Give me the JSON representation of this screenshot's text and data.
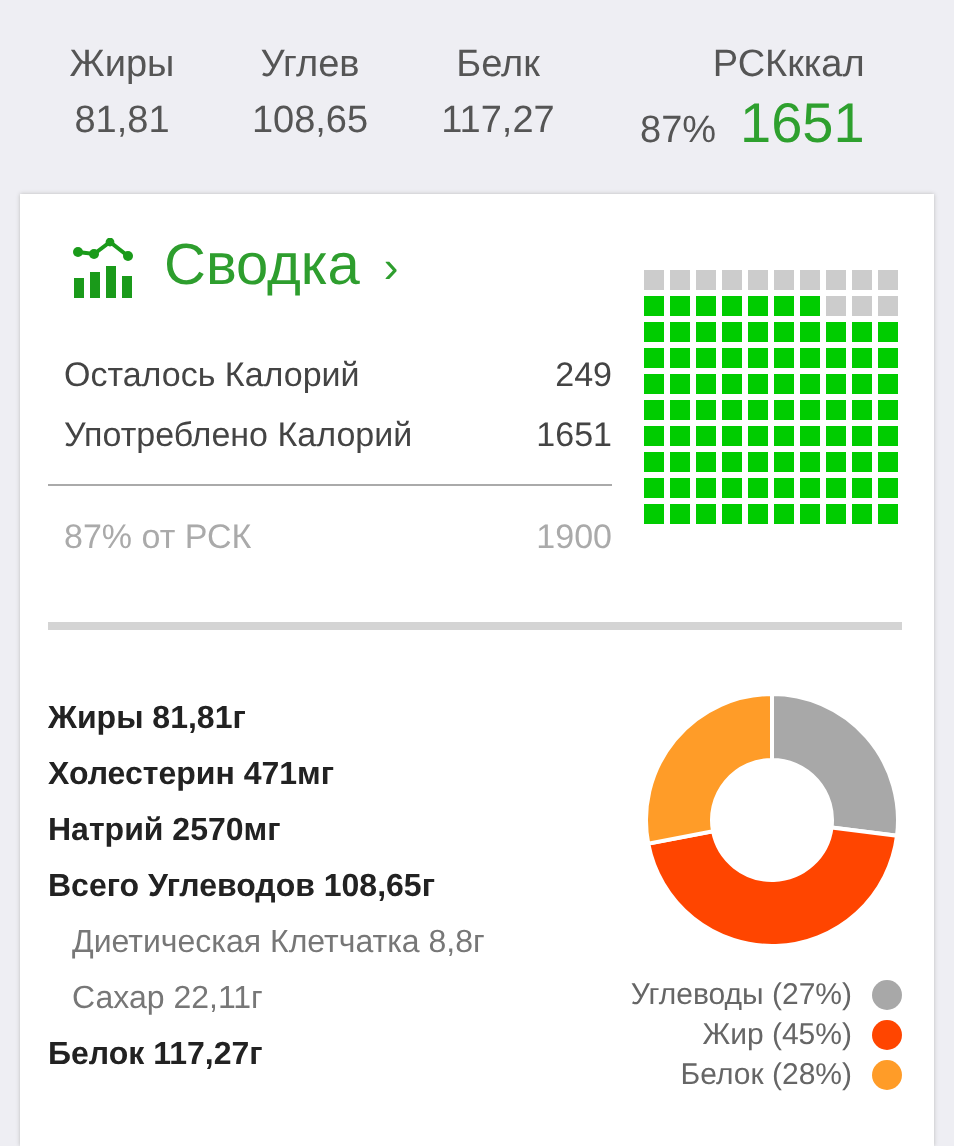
{
  "header": {
    "columns": [
      {
        "label": "Жиры",
        "value": "81,81"
      },
      {
        "label": "Углев",
        "value": "108,65"
      },
      {
        "label": "Белк",
        "value": "117,27"
      }
    ],
    "rsk": {
      "label": "РСКккал",
      "percent": "87%",
      "value": "1651"
    }
  },
  "summary": {
    "title": "Сводка",
    "chevron": "›",
    "rows": [
      {
        "label": "Осталось Калорий",
        "value": "249"
      },
      {
        "label": "Употреблено Калорий",
        "value": "1651"
      }
    ],
    "footer": {
      "label": "87% от РСК",
      "value": "1900"
    },
    "grid": {
      "rows": [
        {
          "cells": [
            {
              "on": false
            },
            {
              "on": false
            },
            {
              "on": false
            },
            {
              "on": false
            },
            {
              "on": false
            },
            {
              "on": false
            },
            {
              "on": false
            },
            {
              "on": false
            },
            {
              "on": false
            },
            {
              "on": false
            }
          ]
        },
        {
          "cells": [
            {
              "on": true
            },
            {
              "on": true
            },
            {
              "on": true
            },
            {
              "on": true
            },
            {
              "on": true
            },
            {
              "on": true
            },
            {
              "on": true
            },
            {
              "on": false
            },
            {
              "on": false
            },
            {
              "on": false
            }
          ]
        },
        {
          "cells": [
            {
              "on": true
            },
            {
              "on": true
            },
            {
              "on": true
            },
            {
              "on": true
            },
            {
              "on": true
            },
            {
              "on": true
            },
            {
              "on": true
            },
            {
              "on": true
            },
            {
              "on": true
            },
            {
              "on": true
            }
          ]
        },
        {
          "cells": [
            {
              "on": true
            },
            {
              "on": true
            },
            {
              "on": true
            },
            {
              "on": true
            },
            {
              "on": true
            },
            {
              "on": true
            },
            {
              "on": true
            },
            {
              "on": true
            },
            {
              "on": true
            },
            {
              "on": true
            }
          ]
        },
        {
          "cells": [
            {
              "on": true
            },
            {
              "on": true
            },
            {
              "on": true
            },
            {
              "on": true
            },
            {
              "on": true
            },
            {
              "on": true
            },
            {
              "on": true
            },
            {
              "on": true
            },
            {
              "on": true
            },
            {
              "on": true
            }
          ]
        },
        {
          "cells": [
            {
              "on": true
            },
            {
              "on": true
            },
            {
              "on": true
            },
            {
              "on": true
            },
            {
              "on": true
            },
            {
              "on": true
            },
            {
              "on": true
            },
            {
              "on": true
            },
            {
              "on": true
            },
            {
              "on": true
            }
          ]
        },
        {
          "cells": [
            {
              "on": true
            },
            {
              "on": true
            },
            {
              "on": true
            },
            {
              "on": true
            },
            {
              "on": true
            },
            {
              "on": true
            },
            {
              "on": true
            },
            {
              "on": true
            },
            {
              "on": true
            },
            {
              "on": true
            }
          ]
        },
        {
          "cells": [
            {
              "on": true
            },
            {
              "on": true
            },
            {
              "on": true
            },
            {
              "on": true
            },
            {
              "on": true
            },
            {
              "on": true
            },
            {
              "on": true
            },
            {
              "on": true
            },
            {
              "on": true
            },
            {
              "on": true
            }
          ]
        },
        {
          "cells": [
            {
              "on": true
            },
            {
              "on": true
            },
            {
              "on": true
            },
            {
              "on": true
            },
            {
              "on": true
            },
            {
              "on": true
            },
            {
              "on": true
            },
            {
              "on": true
            },
            {
              "on": true
            },
            {
              "on": true
            }
          ]
        },
        {
          "cells": [
            {
              "on": true
            },
            {
              "on": true
            },
            {
              "on": true
            },
            {
              "on": true
            },
            {
              "on": true
            },
            {
              "on": true
            },
            {
              "on": true
            },
            {
              "on": true
            },
            {
              "on": true
            },
            {
              "on": true
            }
          ]
        }
      ]
    }
  },
  "nutrients": [
    {
      "kind": "main",
      "text": "Жиры 81,81г"
    },
    {
      "kind": "main",
      "text": "Холестерин 471мг"
    },
    {
      "kind": "main",
      "text": "Натрий 2570мг"
    },
    {
      "kind": "main",
      "text": "Всего Углеводов 108,65г"
    },
    {
      "kind": "sub",
      "text": "Диетическая Клетчатка 8,8г"
    },
    {
      "kind": "sub",
      "text": "Сахар 22,11г"
    },
    {
      "kind": "main",
      "text": "Белок 117,27г"
    }
  ],
  "chart_data": {
    "type": "donut",
    "categories": [
      "Углеводы (27%)",
      "Жир (45%)",
      "Белок (28%)"
    ],
    "series": [
      {
        "values": [
          27,
          45,
          28
        ]
      }
    ],
    "legend": true,
    "colors": [
      "#a8a8a8",
      "#ff4500",
      "#ff9c28"
    ]
  }
}
